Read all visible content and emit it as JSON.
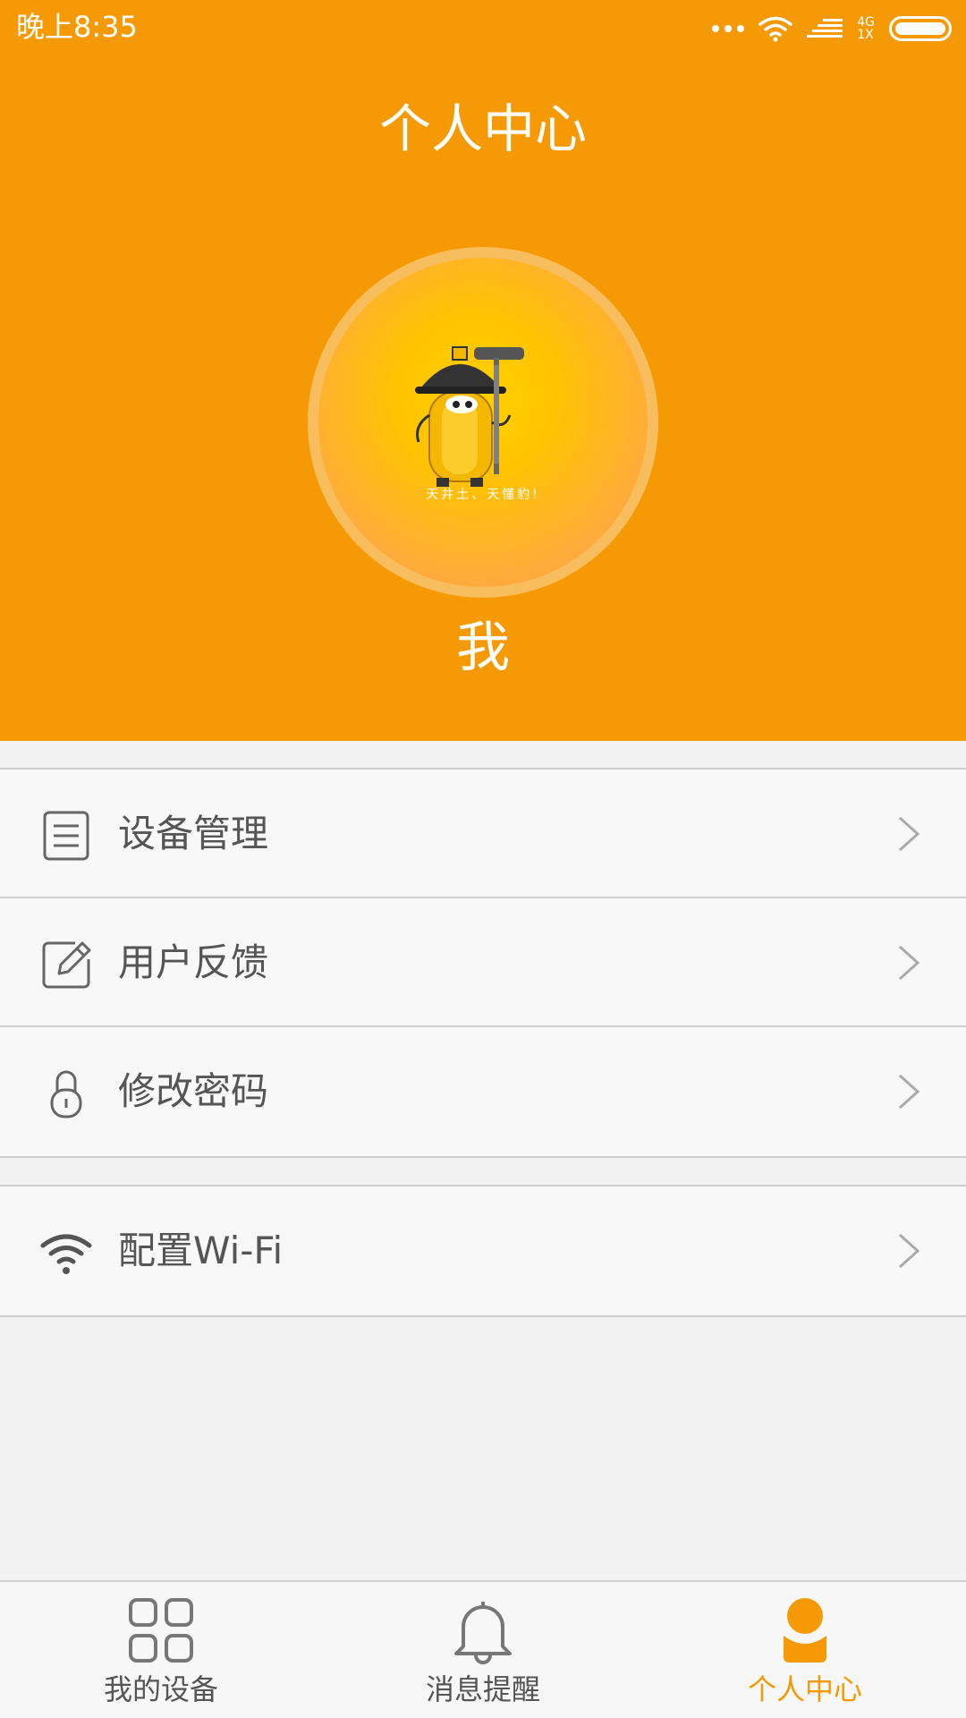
{
  "status_bar": {
    "time": "晚上8:35",
    "network_top": "4G",
    "network_bottom": "1X",
    "icons": [
      "more-dots-icon",
      "wifi-icon",
      "signal-icon",
      "battery-icon"
    ]
  },
  "header": {
    "title": "个人中心",
    "avatar_caption": "天井土、天懂豹!",
    "username": "我"
  },
  "menu": {
    "items": [
      {
        "label": "设备管理",
        "icon": "list-icon"
      },
      {
        "label": "用户反馈",
        "icon": "edit-icon"
      },
      {
        "label": "修改密码",
        "icon": "lock-icon"
      }
    ],
    "wifi": {
      "label": "配置Wi-Fi",
      "icon": "wifi-icon"
    }
  },
  "bottom_nav": {
    "items": [
      {
        "label": "我的设备",
        "icon": "grid-icon",
        "active": false
      },
      {
        "label": "消息提醒",
        "icon": "bell-icon",
        "active": false
      },
      {
        "label": "个人中心",
        "icon": "person-icon",
        "active": true
      }
    ]
  },
  "colors": {
    "accent": "#f59a05",
    "text": "#555555",
    "divider": "#cfcfcf",
    "background": "#f2f2f2"
  }
}
